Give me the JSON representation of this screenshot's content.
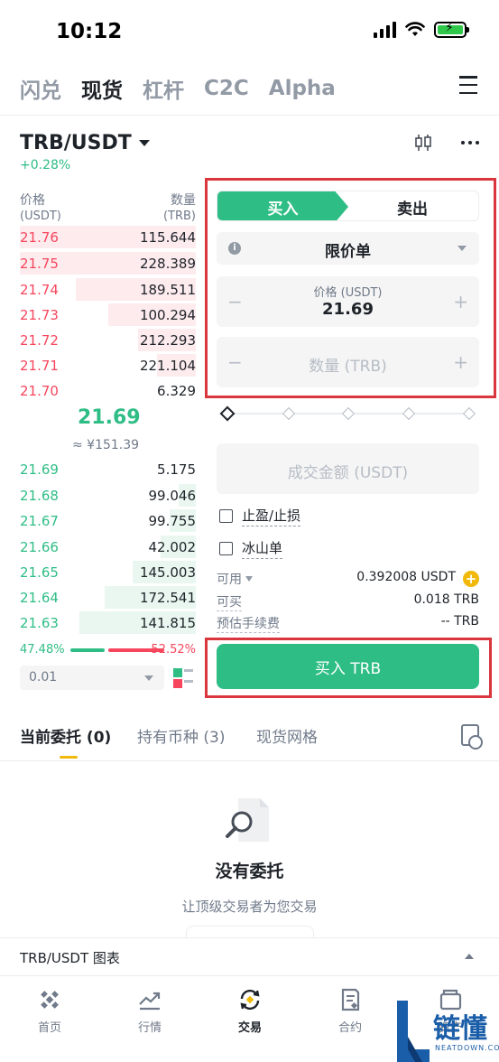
{
  "status": {
    "time": "10:12"
  },
  "topnav": {
    "tabs": [
      "闪兑",
      "现货",
      "杠杆",
      "C2C",
      "Alpha"
    ],
    "active": 1
  },
  "pair": {
    "symbol": "TRB/USDT",
    "change": "+0.28%"
  },
  "orderbook": {
    "price_label": "价格",
    "price_unit": "(USDT)",
    "qty_label": "数量",
    "qty_unit": "(TRB)",
    "asks": [
      {
        "price": "21.76",
        "qty": "115.644",
        "depth": 1.0
      },
      {
        "price": "21.75",
        "qty": "228.389",
        "depth": 1.0
      },
      {
        "price": "21.74",
        "qty": "189.511",
        "depth": 0.68
      },
      {
        "price": "21.73",
        "qty": "100.294",
        "depth": 0.5
      },
      {
        "price": "21.72",
        "qty": "212.293",
        "depth": 0.33
      },
      {
        "price": "21.71",
        "qty": "221.104",
        "depth": 0.22
      },
      {
        "price": "21.70",
        "qty": "6.329",
        "depth": 0.0
      }
    ],
    "mid_price": "21.69",
    "mid_cny": "≈ ¥151.39",
    "bids": [
      {
        "price": "21.69",
        "qty": "5.175",
        "depth": 0.0
      },
      {
        "price": "21.68",
        "qty": "99.046",
        "depth": 0.1
      },
      {
        "price": "21.67",
        "qty": "99.755",
        "depth": 0.15
      },
      {
        "price": "21.66",
        "qty": "42.002",
        "depth": 0.2
      },
      {
        "price": "21.65",
        "qty": "145.003",
        "depth": 0.36
      },
      {
        "price": "21.64",
        "qty": "172.541",
        "depth": 0.52
      },
      {
        "price": "21.63",
        "qty": "141.815",
        "depth": 0.66
      }
    ],
    "buy_ratio": "47.48%",
    "sell_ratio": "52.52%",
    "precision": "0.01"
  },
  "form": {
    "buy_tab": "买入",
    "sell_tab": "卖出",
    "order_type": "限价单",
    "price_label": "价格 (USDT)",
    "price_value": "21.69",
    "qty_placeholder": "数量 (TRB)",
    "total_placeholder": "成交金额 (USDT)",
    "tp_sl": "止盈/止损",
    "iceberg": "冰山单",
    "available_label": "可用",
    "available_value": "0.392008 USDT",
    "can_buy_label": "可买",
    "can_buy_value": "0.018 TRB",
    "fee_label": "预估手续费",
    "fee_value": "-- TRB",
    "buy_button": "买入 TRB"
  },
  "orders": {
    "tabs": [
      "当前委托 (0)",
      "持有币种 (3)",
      "现货网格"
    ],
    "empty_title": "没有委托",
    "empty_sub": "让顶级交易者为您交易"
  },
  "chart_bar": {
    "title": "TRB/USDT 图表"
  },
  "bottom_nav": [
    "首页",
    "行情",
    "交易",
    "合约",
    "资产"
  ],
  "watermark": {
    "text": "链懂",
    "sub": "NEATDOWN.COM"
  },
  "colors": {
    "green": "#2ebd85",
    "red": "#f6465d",
    "highlight": "#d9363e",
    "yellow": "#f0b90b"
  }
}
